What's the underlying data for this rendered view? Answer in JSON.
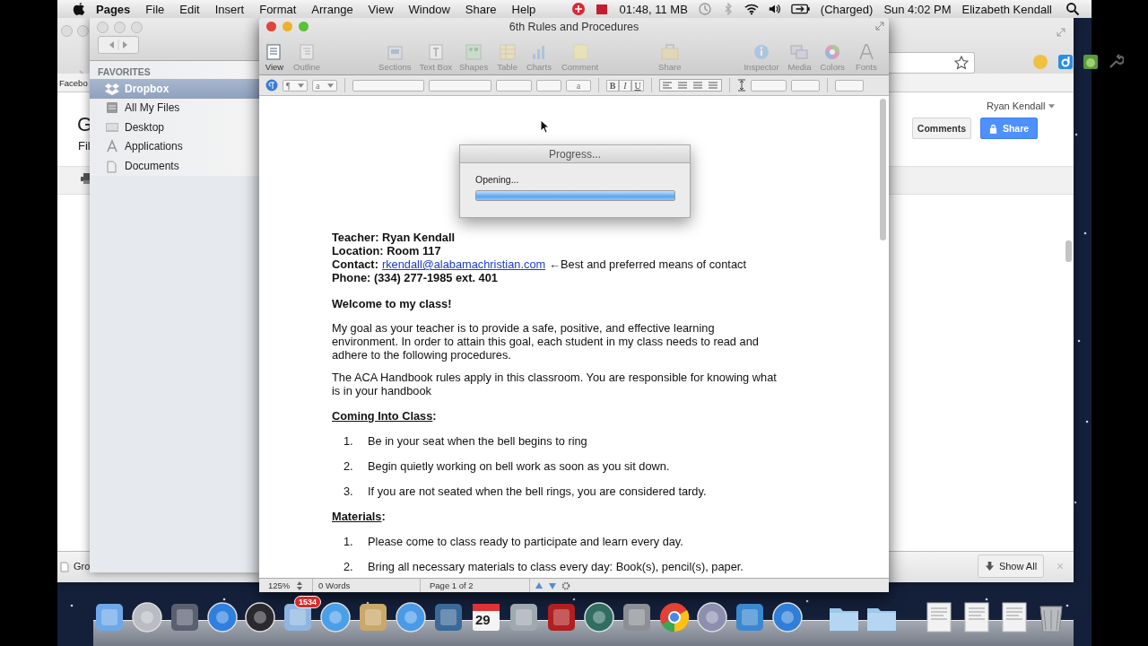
{
  "menu_bar": {
    "app": "Pages",
    "menus": [
      "File",
      "Edit",
      "Insert",
      "Format",
      "Arrange",
      "View",
      "Window",
      "Share",
      "Help"
    ],
    "recording": "01:48, 11 MB",
    "battery": "(Charged)",
    "clock": "Sun 4:02 PM",
    "user": "Elizabeth Kendall"
  },
  "browser": {
    "bookmark": "Facebo",
    "page_title": "G",
    "page_menu": "Fil",
    "account": "Ryan Kendall",
    "comments_button": "Comments",
    "share_button": "Share",
    "download": "Gro",
    "show_all": "Show All",
    "close": "×"
  },
  "finder": {
    "section": "FAVORITES",
    "items": [
      {
        "label": "Dropbox",
        "selected": true
      },
      {
        "label": "All My Files",
        "selected": false
      },
      {
        "label": "Desktop",
        "selected": false
      },
      {
        "label": "Applications",
        "selected": false
      },
      {
        "label": "Documents",
        "selected": false
      }
    ]
  },
  "pages": {
    "title": "6th Rules and Procedures",
    "toolbar": [
      {
        "label": "View",
        "disabled": false
      },
      {
        "label": "Outline",
        "disabled": true
      },
      {
        "label": "Sections",
        "disabled": true
      },
      {
        "label": "Text Box",
        "disabled": true
      },
      {
        "label": "Shapes",
        "disabled": true
      },
      {
        "label": "Table",
        "disabled": true
      },
      {
        "label": "Charts",
        "disabled": true
      },
      {
        "label": "Comment",
        "disabled": true
      },
      {
        "label": "Share",
        "disabled": true
      },
      {
        "label": "Inspector",
        "disabled": true
      },
      {
        "label": "Media",
        "disabled": true
      },
      {
        "label": "Colors",
        "disabled": true
      },
      {
        "label": "Fonts",
        "disabled": true
      }
    ],
    "format_bar": {
      "paragraph": "¶",
      "char_style": "a",
      "list_style": "a",
      "bold": "B",
      "italic": "I",
      "underline": "U"
    },
    "document": {
      "header": [
        {
          "kind": "text",
          "text": "Teacher: Ryan Kendall"
        },
        {
          "kind": "text",
          "text": "Location: Room 117"
        },
        {
          "kind": "contact",
          "label": "Contact:",
          "link": "rkendall@alabamachristian.com",
          "note": "←Best and preferred means of contact"
        },
        {
          "kind": "text",
          "text": "Phone: (334) 277-1985 ext. 401"
        }
      ],
      "welcome": "Welcome to my class!",
      "paragraphs": [
        "My goal as your teacher is to provide a safe, positive, and effective learning environment. In order to attain this goal, each student in my class needs to read and adhere to the following procedures.",
        "The ACA Handbook rules apply in this classroom. You are responsible for knowing what is in your handbook"
      ],
      "sections": [
        {
          "heading": "Coming Into Class",
          "punct": ":",
          "items": [
            {
              "number": "1.",
              "text": "Be in your seat when the bell begins to ring"
            },
            {
              "number": "2.",
              "text": "Begin quietly working on bell work as soon as you sit down."
            },
            {
              "number": "3.",
              "text": "If you are not seated when the bell rings, you are considered tardy."
            }
          ]
        },
        {
          "heading": "Materials",
          "punct": ":",
          "items": [
            {
              "number": "1.",
              "text": "Please come to class ready to participate and learn every day."
            },
            {
              "number": "2.",
              "text": "Bring all necessary materials to class every day: Book(s), pencil(s), paper."
            }
          ]
        }
      ]
    },
    "progress": {
      "title": "Progress...",
      "message": "Opening...",
      "level": 1
    },
    "status_bar": {
      "zoom": "125%",
      "words": "0 Words",
      "page": "Page 1 of 2"
    }
  },
  "dock": {
    "mail_badge": "1534",
    "calendar_day": "29"
  }
}
